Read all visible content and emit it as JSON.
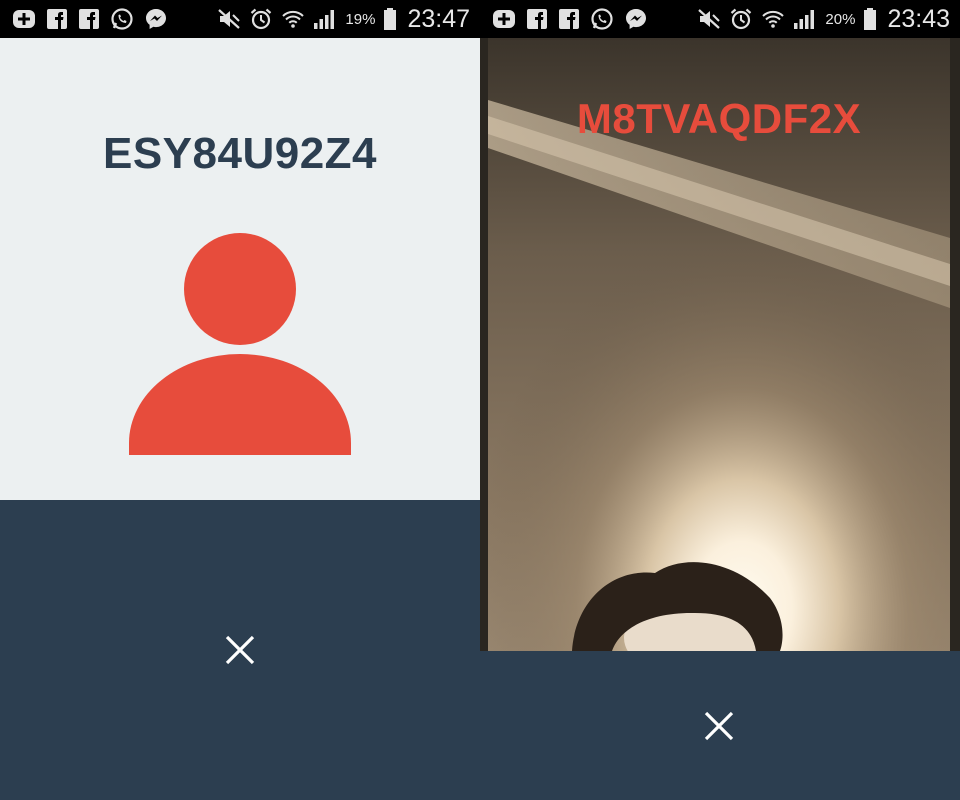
{
  "colors": {
    "accent": "#e74c3c",
    "panel": "#2c3e50",
    "card": "#ecf0f1",
    "statusbar": "#000000"
  },
  "screens": [
    {
      "status_bar": {
        "notification_icons": [
          "add-notification-icon",
          "facebook-icon",
          "facebook-icon",
          "whatsapp-icon",
          "messenger-icon"
        ],
        "system_icons": [
          "mute-icon",
          "alarm-icon",
          "wifi-icon",
          "signal-icon"
        ],
        "battery_percent": "19%",
        "time": "23:47"
      },
      "caller_id": "ESY84U92Z4",
      "avatar_icon": "person-icon",
      "hangup_icon": "close-icon"
    },
    {
      "status_bar": {
        "notification_icons": [
          "add-notification-icon",
          "facebook-icon",
          "facebook-icon",
          "whatsapp-icon",
          "messenger-icon"
        ],
        "system_icons": [
          "mute-icon",
          "alarm-icon",
          "wifi-icon",
          "signal-icon"
        ],
        "battery_percent": "20%",
        "time": "23:43"
      },
      "caller_id": "M8TVAQDF2X",
      "video_feed": "camera-video",
      "hangup_icon": "close-icon"
    }
  ]
}
